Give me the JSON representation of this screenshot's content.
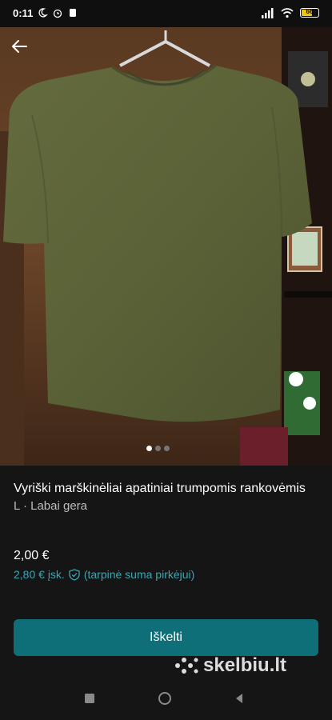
{
  "status": {
    "time": "0:11",
    "battery": "66"
  },
  "listing": {
    "title": "Vyriški marškinėliai apatiniai trumpomis rankovėmis",
    "subtitle": "L · Labai gera",
    "price": "2,00 €",
    "price_incl": "2,80 € įsk.",
    "price_note": "(tarpinė suma pirkėjui)",
    "carousel": {
      "total": 3,
      "active": 1
    }
  },
  "actions": {
    "primary_label": "Iškelti"
  },
  "watermark": {
    "brand": "skelbiu.lt"
  },
  "colors": {
    "accent": "#0f6f78",
    "link": "#3aa6b3",
    "tshirt": "#5d6438"
  },
  "icons": [
    "back-arrow-icon",
    "shield-check-icon",
    "moon-icon",
    "alarm-icon",
    "signal-icon",
    "wifi-icon",
    "battery-icon"
  ]
}
